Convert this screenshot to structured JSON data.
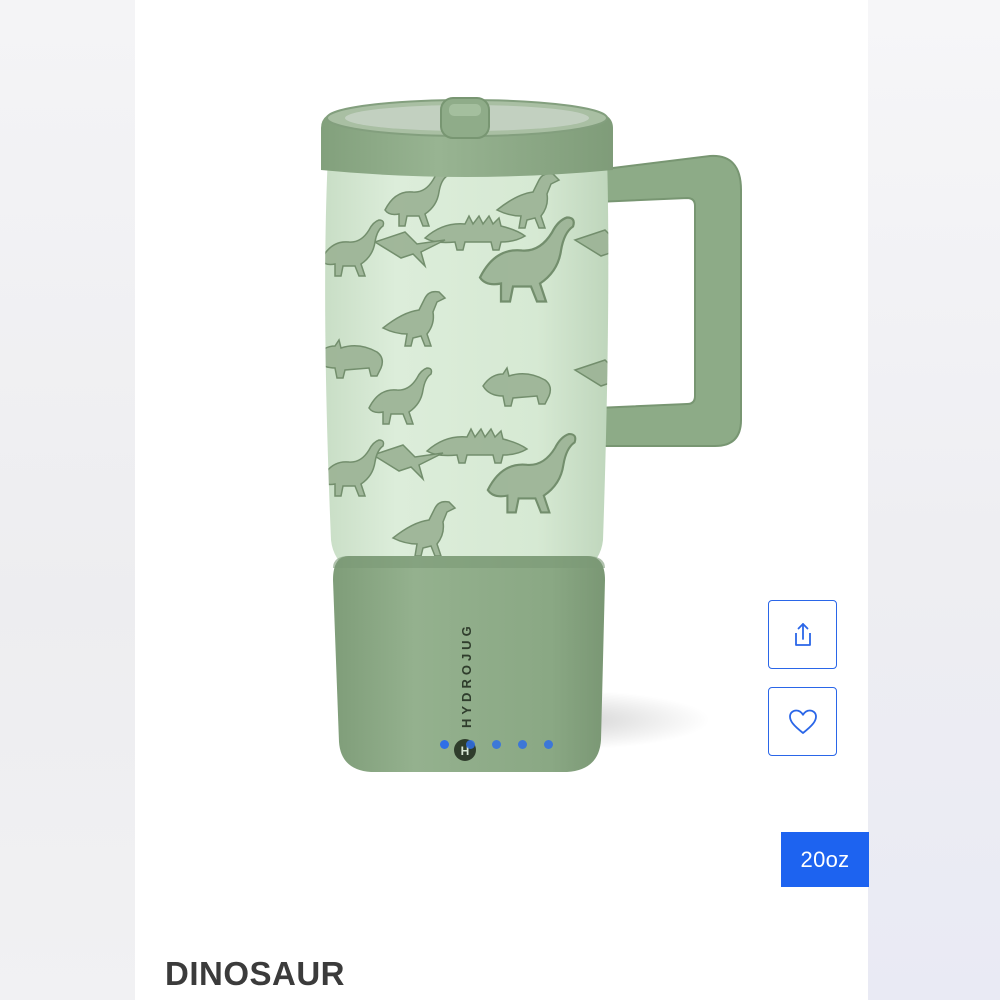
{
  "product": {
    "title": "DINOSAUR",
    "size_label": "20oz",
    "brand_mark": "HYDROJUG",
    "image_icon": "dinosaur-pattern-tumbler",
    "gallery": {
      "total": 5,
      "active_index": 1
    }
  },
  "actions": {
    "share_icon": "share-icon",
    "favorite_icon": "heart-icon"
  },
  "colors": {
    "accent": "#1d63f0",
    "tumbler_green": "#8fac89",
    "tumbler_light": "#d8ebd6",
    "title_text": "#3b3b3b"
  }
}
